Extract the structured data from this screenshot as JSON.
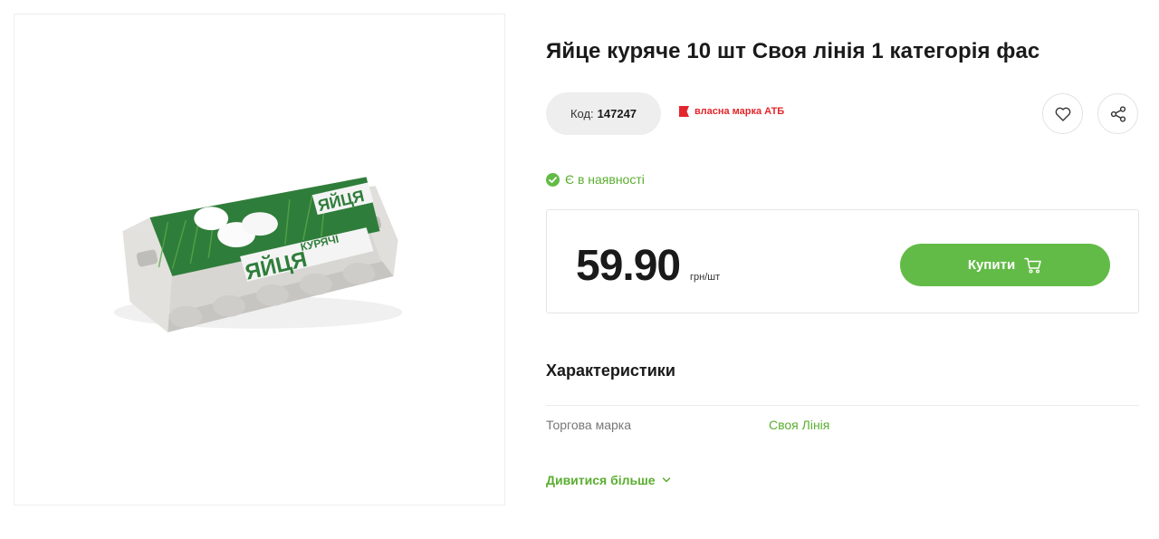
{
  "product": {
    "title": "Яйце куряче 10 шт Своя лінія 1 категорія фас",
    "code_label": "Код:",
    "code_value": "147247",
    "brand_tag": "власна марка АТБ",
    "stock_status": "Є в наявності",
    "price": "59.90",
    "price_unit": "грн/шт",
    "buy_label": "Купити",
    "image_label_main": "ЯЙЦЯ",
    "image_label_sub": "КУРЯЧІ"
  },
  "characteristics": {
    "title": "Характеристики",
    "rows": [
      {
        "name": "Торгова марка",
        "value": "Своя Лінія"
      }
    ],
    "more_label": "Дивитися більше"
  },
  "icons": {
    "favorite": "heart-icon",
    "share": "share-icon",
    "cart": "cart-icon",
    "stock": "check-circle-icon",
    "brand": "flag-icon",
    "more": "chevron-down-icon"
  },
  "colors": {
    "accent_green": "#62bb46",
    "text_green": "#5aae30",
    "brand_red": "#e3262d",
    "text_dark": "#1a1a1a"
  }
}
